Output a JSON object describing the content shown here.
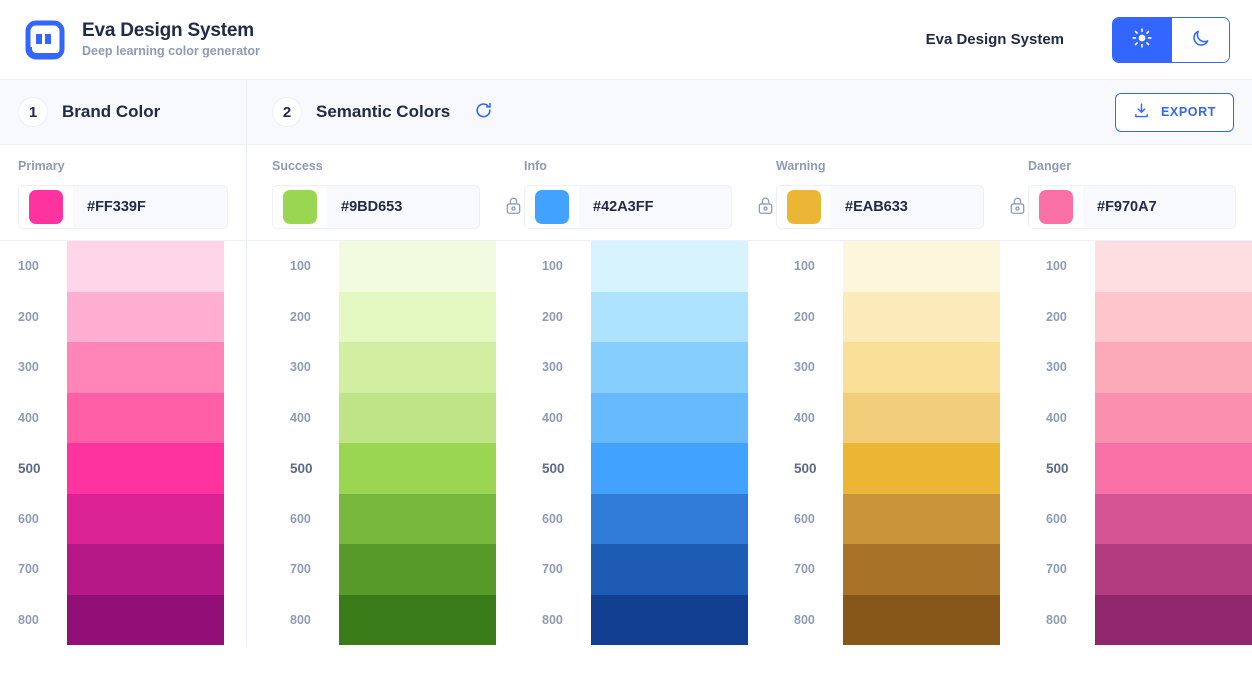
{
  "header": {
    "logo_icon": "eva-logo-icon",
    "brand_title": "Eva Design System",
    "brand_subtitle": "Deep learning color generator",
    "app_name": "Eva Design System",
    "theme": {
      "light_icon": "sun-icon",
      "dark_icon": "moon-icon",
      "active": "light"
    }
  },
  "sections": {
    "brand": {
      "step": "1",
      "title": "Brand Color"
    },
    "semantic": {
      "step": "2",
      "title": "Semantic Colors",
      "refresh_icon": "refresh-icon"
    },
    "export": {
      "label": "EXPORT",
      "icon": "download-icon",
      "accent": "#3366FF"
    }
  },
  "colors": [
    {
      "name": "Primary",
      "hex": "#FF339F",
      "locked": false,
      "lock_icon": "unlock-icon",
      "group": "brand",
      "shades": [
        {
          "level": "100",
          "hex": "#FFD6E8"
        },
        {
          "level": "200",
          "hex": "#FFB0D2"
        },
        {
          "level": "300",
          "hex": "#FF84B7"
        },
        {
          "level": "400",
          "hex": "#FF5FA6"
        },
        {
          "level": "500",
          "hex": "#FF339F"
        },
        {
          "level": "600",
          "hex": "#DB2395"
        },
        {
          "level": "700",
          "hex": "#B71888"
        },
        {
          "level": "800",
          "hex": "#930F78"
        }
      ]
    },
    {
      "name": "Success",
      "hex": "#9BD653",
      "locked": false,
      "lock_icon": "unlock-icon",
      "group": "semantic",
      "shades": [
        {
          "level": "100",
          "hex": "#F2FBDF"
        },
        {
          "level": "200",
          "hex": "#E4F8C1"
        },
        {
          "level": "300",
          "hex": "#D2EFA1"
        },
        {
          "level": "400",
          "hex": "#BEE487"
        },
        {
          "level": "500",
          "hex": "#9BD653"
        },
        {
          "level": "600",
          "hex": "#78B83D"
        },
        {
          "level": "700",
          "hex": "#589A2A"
        },
        {
          "level": "800",
          "hex": "#3B7C1A"
        }
      ]
    },
    {
      "name": "Info",
      "hex": "#42A3FF",
      "locked": false,
      "lock_icon": "unlock-icon",
      "group": "semantic",
      "shades": [
        {
          "level": "100",
          "hex": "#D6F3FE"
        },
        {
          "level": "200",
          "hex": "#AEE3FE"
        },
        {
          "level": "300",
          "hex": "#85CEFD"
        },
        {
          "level": "400",
          "hex": "#66B9FB"
        },
        {
          "level": "500",
          "hex": "#42A3FF"
        },
        {
          "level": "600",
          "hex": "#307CD8"
        },
        {
          "level": "700",
          "hex": "#1E5BB5"
        },
        {
          "level": "800",
          "hex": "#133F92"
        }
      ]
    },
    {
      "name": "Warning",
      "hex": "#EAB633",
      "locked": false,
      "lock_icon": "unlock-icon",
      "group": "semantic",
      "shades": [
        {
          "level": "100",
          "hex": "#FDF6DC"
        },
        {
          "level": "200",
          "hex": "#FCEBBA"
        },
        {
          "level": "300",
          "hex": "#F8DE96"
        },
        {
          "level": "400",
          "hex": "#F3CE7A"
        },
        {
          "level": "500",
          "hex": "#EAB633"
        },
        {
          "level": "600",
          "hex": "#C9943A"
        },
        {
          "level": "700",
          "hex": "#A87328"
        },
        {
          "level": "800",
          "hex": "#875619"
        }
      ]
    },
    {
      "name": "Danger",
      "hex": "#F970A7",
      "locked": false,
      "lock_icon": "unlock-icon",
      "group": "semantic",
      "shades": [
        {
          "level": "100",
          "hex": "#FEDEE1"
        },
        {
          "level": "200",
          "hex": "#FDC6CC"
        },
        {
          "level": "300",
          "hex": "#FCA9BA"
        },
        {
          "level": "400",
          "hex": "#FA8FB0"
        },
        {
          "level": "500",
          "hex": "#F970A7"
        },
        {
          "level": "600",
          "hex": "#D65494"
        },
        {
          "level": "700",
          "hex": "#B33B80"
        },
        {
          "level": "800",
          "hex": "#90276C"
        }
      ]
    }
  ]
}
